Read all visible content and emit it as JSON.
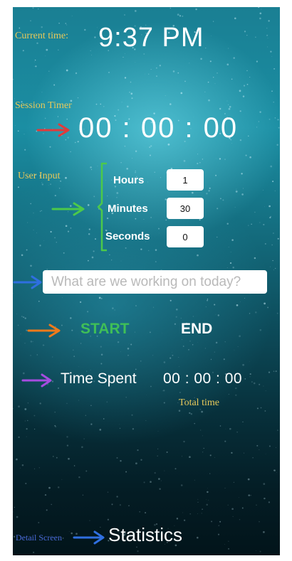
{
  "annotations": {
    "current_time": "Current time:",
    "session_timer": "Session Timer",
    "user_input": "User Input",
    "total_time": "Total time",
    "detail_screen": "Detail Screen"
  },
  "clock": {
    "time": "9:37 PM"
  },
  "session_timer": {
    "value": "00 : 00 : 00"
  },
  "inputs": {
    "hours_label": "Hours",
    "hours_value": "1",
    "minutes_label": "Minutes",
    "minutes_value": "30",
    "seconds_label": "Seconds",
    "seconds_value": "0"
  },
  "task": {
    "placeholder": "What are we working on today?"
  },
  "actions": {
    "start_label": "START",
    "end_label": "END"
  },
  "time_spent": {
    "label": "Time Spent",
    "value": "00 : 00 : 00"
  },
  "navigation": {
    "statistics_label": "Statistics"
  },
  "colors": {
    "arrow_red": "#e23a3a",
    "arrow_green": "#4cc94a",
    "arrow_blue": "#2f6fe0",
    "arrow_orange": "#f07a1a",
    "arrow_purple": "#a64ce0",
    "annotation_gold": "#e7c95a",
    "start_green": "#3fbf57"
  },
  "icons": [
    "arrow-icon",
    "bracket-icon"
  ]
}
